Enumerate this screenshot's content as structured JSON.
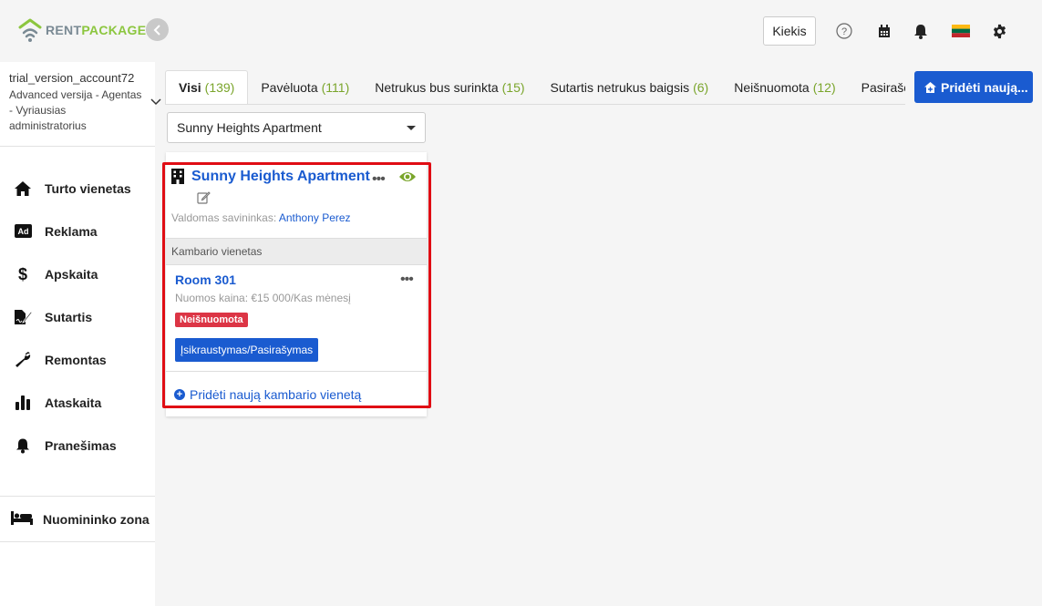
{
  "brand": {
    "part1": "RENT",
    "part2": "PACKAGE",
    "accent": "#8cc63f"
  },
  "topbar": {
    "quantity_label": "Kiekis",
    "icons": [
      "help-icon",
      "calendar-icon",
      "bell-icon",
      "lithuania-flag-icon",
      "gear-icon"
    ]
  },
  "account": {
    "name": "trial_version_account72",
    "role": "Advanced versija - Agentas - Vyriausias administratorius"
  },
  "sidebar": {
    "items": [
      {
        "label": "Turto vienetas",
        "icon": "home-icon"
      },
      {
        "label": "Reklama",
        "icon": "ad-icon"
      },
      {
        "label": "Apskaita",
        "icon": "dollar-icon"
      },
      {
        "label": "Sutartis",
        "icon": "contract-icon"
      },
      {
        "label": "Remontas",
        "icon": "wrench-icon"
      },
      {
        "label": "Ataskaita",
        "icon": "bar-chart-icon"
      },
      {
        "label": "Pranešimas",
        "icon": "bell-icon"
      }
    ],
    "tenant_zone": "Nuomininko zona"
  },
  "tabs": [
    {
      "label": "Visi",
      "count": "(139)"
    },
    {
      "label": "Pavėluota",
      "count": "(111)"
    },
    {
      "label": "Netrukus bus surinkta",
      "count": "(15)"
    },
    {
      "label": "Sutartis netrukus baigsis",
      "count": "(6)"
    },
    {
      "label": "Neišnuomota",
      "count": "(12)"
    },
    {
      "label": "Pasirašor",
      "count": ""
    }
  ],
  "add_new_label": "Pridėti naują...",
  "filter": {
    "selected": "Sunny Heights Apartment"
  },
  "property": {
    "title": "Sunny Heights Apartment",
    "owner_label": "Valdomas savininkas:",
    "owner_name": "Anthony Perez",
    "section_label": "Kambario vienetas",
    "room": {
      "title": "Room 301",
      "price": "Nuomos kaina: €15 000/Kas mėnesį",
      "status": "Neišnuomota",
      "action": "Įsikraustymas/Pasirašymas"
    },
    "add_room_label": "Pridėti naują kambario vienetą"
  },
  "colors": {
    "primary": "#1a5bd0",
    "danger": "#dc3545",
    "highlight": "#e00d14",
    "count_green": "#7aa52b"
  }
}
